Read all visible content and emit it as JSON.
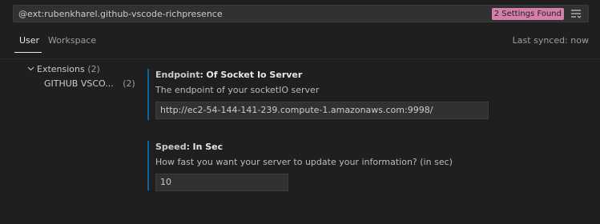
{
  "search": {
    "value": "@ext:rubenkharel.github-vscode-richpresence",
    "results_badge": "2 Settings Found",
    "filter_icon": "filter-list-icon"
  },
  "tabs": [
    {
      "label": "User",
      "active": true
    },
    {
      "label": "Workspace",
      "active": false
    }
  ],
  "last_synced": "Last synced: now",
  "tree": {
    "group": {
      "label": "Extensions",
      "count": "(2)"
    },
    "item": {
      "label": "GITHUB VSCO...",
      "count": "(2)"
    }
  },
  "settings": [
    {
      "category": "Endpoint:",
      "name": "Of Socket Io Server",
      "description": "The endpoint of your socketIO server",
      "value": "http://ec2-54-144-141-239.compute-1.amazonaws.com:9998/"
    },
    {
      "category": "Speed:",
      "name": "In Sec",
      "description": "How fast you want your server to update your information? (in sec)",
      "value": "10"
    }
  ],
  "colors": {
    "background": "#1f1f1f",
    "badge": "#d57eab",
    "accent": "#0e639c"
  }
}
